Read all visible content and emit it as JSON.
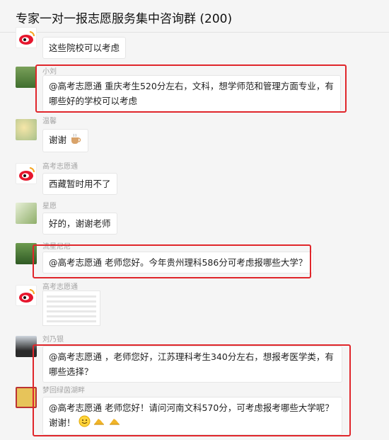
{
  "window": {
    "title": "专家一对一报志愿服务集中咨询群 (200)"
  },
  "messages": [
    {
      "sender": "",
      "text": "这些院校可以考虑",
      "avatar": "weibo-logo-icon"
    },
    {
      "sender": "小刘",
      "text": "@高考志愿通 重庆考生520分左右，文科，想学师范和管理方面专业，有哪些好的学校可以考虑",
      "avatar": "landscape-avatar"
    },
    {
      "sender": "温馨",
      "text": "谢谢",
      "emoji": "coffee-cup-emoji",
      "avatar": "flowers-avatar"
    },
    {
      "sender": "高考志愿通",
      "text": "西藏暂时用不了",
      "avatar": "weibo-logo-icon"
    },
    {
      "sender": "星愿",
      "text": "好的，谢谢老师",
      "avatar": "plant-avatar"
    },
    {
      "sender": "流星尼尼",
      "text": "@高考志愿通 老师您好。今年贵州理科586分可考虑报哪些大学？",
      "avatar": "garden-avatar"
    },
    {
      "sender": "高考志愿通",
      "text": "",
      "image": "table-screenshot-image",
      "avatar": "weibo-logo-icon"
    },
    {
      "sender": "刘乃银",
      "text": "@高考志愿通 ，老师您好，江苏理科考生340分左右，想报考医学类，有哪些选择？",
      "avatar": "person-avatar"
    },
    {
      "sender": "梦回绿茵湖畔",
      "text": "@高考志愿通 老师您好！请问河南文科570分，可考虑报考哪些大学呢？谢谢！",
      "emoji": "smile-emoji, thumbs-emoji, thumbs-emoji",
      "avatar": "certificate-avatar"
    }
  ],
  "colors": {
    "highlight": "#e0262b",
    "background": "#f5f5f5",
    "bubble": "#ffffff",
    "weibo_red": "#e6162d"
  }
}
